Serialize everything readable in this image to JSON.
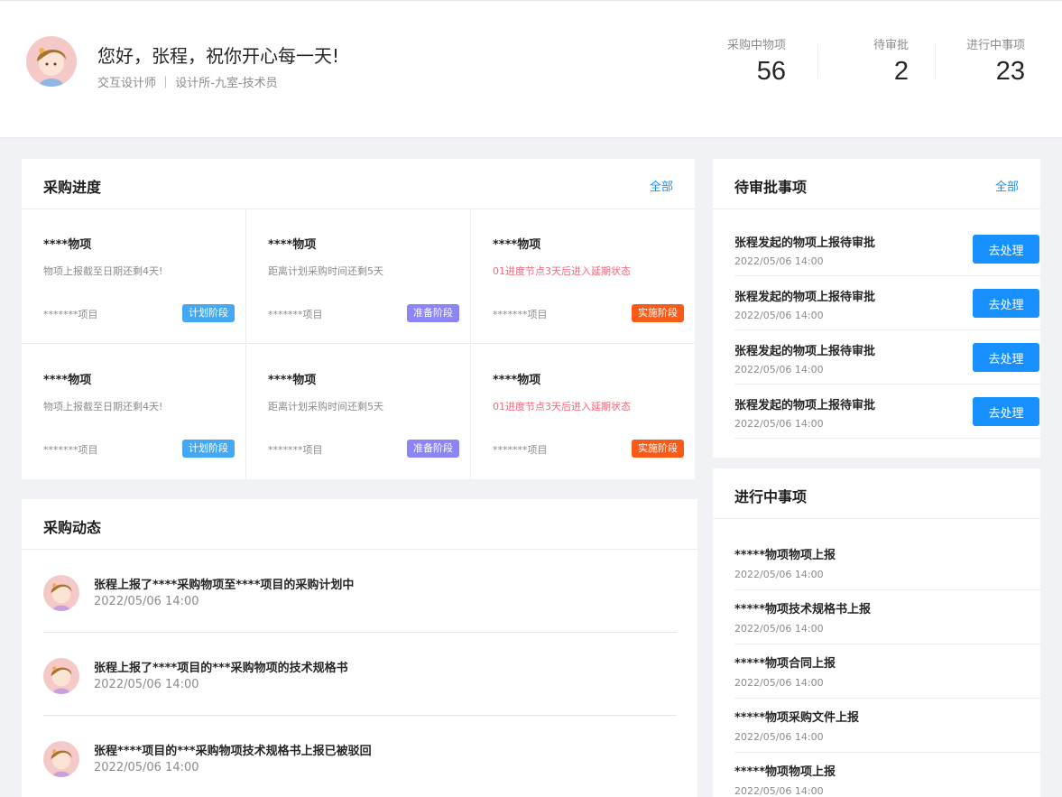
{
  "header": {
    "greeting": "您好，张程，祝你开心每一天!",
    "subtitle": "交互设计师 ｜ 设计所-九室-技术员",
    "stats": [
      {
        "label": "采购中物项",
        "value": "56"
      },
      {
        "label": "待审批",
        "value": "2"
      },
      {
        "label": "进行中事项",
        "value": "23"
      }
    ]
  },
  "progress": {
    "title": "采购进度",
    "link": "全部",
    "cells": [
      {
        "title": "****物项",
        "desc": "物项上报截至日期还剩4天!",
        "project": "*******项目",
        "tag": "计划阶段",
        "tag_color": "#44a8f5"
      },
      {
        "title": "****物项",
        "desc": "距离计划采购时间还剩5天",
        "project": "*******项目",
        "tag": "准备阶段",
        "tag_color": "#8c85f7"
      },
      {
        "title": "****物项",
        "desc": "01进度节点3天后进入延期状态",
        "project": "*******项目",
        "tag": "实施阶段",
        "tag_color": "#fa5a15"
      },
      {
        "title": "****物项",
        "desc": "物项上报截至日期还剩4天!",
        "project": "*******项目",
        "tag": "计划阶段",
        "tag_color": "#44a8f5"
      },
      {
        "title": "****物项",
        "desc": "距离计划采购时间还剩5天",
        "project": "*******项目",
        "tag": "准备阶段",
        "tag_color": "#8c85f7"
      },
      {
        "title": "****物项",
        "desc": "01进度节点3天后进入延期状态",
        "project": "*******项目",
        "tag": "实施阶段",
        "tag_color": "#fa5a15"
      }
    ]
  },
  "approvals": {
    "title": "待审批事项",
    "link": "全部",
    "items": [
      {
        "title": "张程发起的物项上报待审批",
        "time": "2022/05/06 14:00",
        "button": "去处理"
      },
      {
        "title": "张程发起的物项上报待审批",
        "time": "2022/05/06 14:00",
        "button": "去处理"
      },
      {
        "title": "张程发起的物项上报待审批",
        "time": "2022/05/06 14:00",
        "button": "去处理"
      },
      {
        "title": "张程发起的物项上报待审批",
        "time": "2022/05/06 14:00",
        "button": "去处理"
      }
    ]
  },
  "activity": {
    "title": "采购动态",
    "items": [
      {
        "text": "张程上报了****采购物项至****项目的采购计划中",
        "time": "2022/05/06 14:00"
      },
      {
        "text": "张程上报了****项目的***采购物项的技术规格书",
        "time": "2022/05/06 14:00"
      },
      {
        "text": "张程****项目的***采购物项技术规格书上报已被驳回",
        "time": "2022/05/06 14:00"
      }
    ]
  },
  "ongoing": {
    "title": "进行中事项",
    "items": [
      {
        "title": "*****物项物项上报",
        "time": "2022/05/06 14:00"
      },
      {
        "title": "*****物项技术规格书上报",
        "time": "2022/05/06 14:00"
      },
      {
        "title": "*****物项合同上报",
        "time": "2022/05/06 14:00"
      },
      {
        "title": "*****物项采购文件上报",
        "time": "2022/05/06 14:00"
      },
      {
        "title": "*****物项物项上报",
        "time": "2022/05/06 14:00"
      }
    ]
  }
}
